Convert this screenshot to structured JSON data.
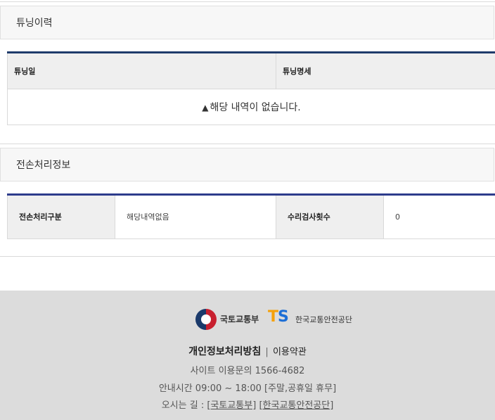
{
  "tuning_section": {
    "title": "튜닝이력",
    "columns": [
      "튜닝일",
      "튜닝명세"
    ],
    "empty_icon": "warning-icon",
    "empty_message": "해당 내역이 없습니다."
  },
  "transfer_section": {
    "title": "전손처리정보",
    "label1": "전손처리구분",
    "value1": "해당내역없음",
    "label2": "수리검사횟수",
    "value2": "0"
  },
  "footer": {
    "motie_name": "국토교통부",
    "kotsa_mark": [
      "T",
      "S"
    ],
    "kotsa_name": "한국교통안전공단",
    "privacy_link": "개인정보처리방침",
    "divider": "|",
    "terms_link": "이용약관",
    "site_inquiry": "사이트 이용문의 1566-4682",
    "hours": "안내시간 09:00 ~ 18:00 [주말,공휴일 휴무]",
    "directions_label": "오시는 길 :",
    "directions_link1": "[국토교통부]",
    "directions_link2": "[한국교통안전공단]"
  },
  "colors": {
    "header_bar": "#1f3b6b",
    "transfer_bar": "#2d3c8c",
    "footer_bg": "#dcdcdc",
    "ts_orange": "#f5a10a",
    "ts_blue": "#1d6fd6"
  }
}
